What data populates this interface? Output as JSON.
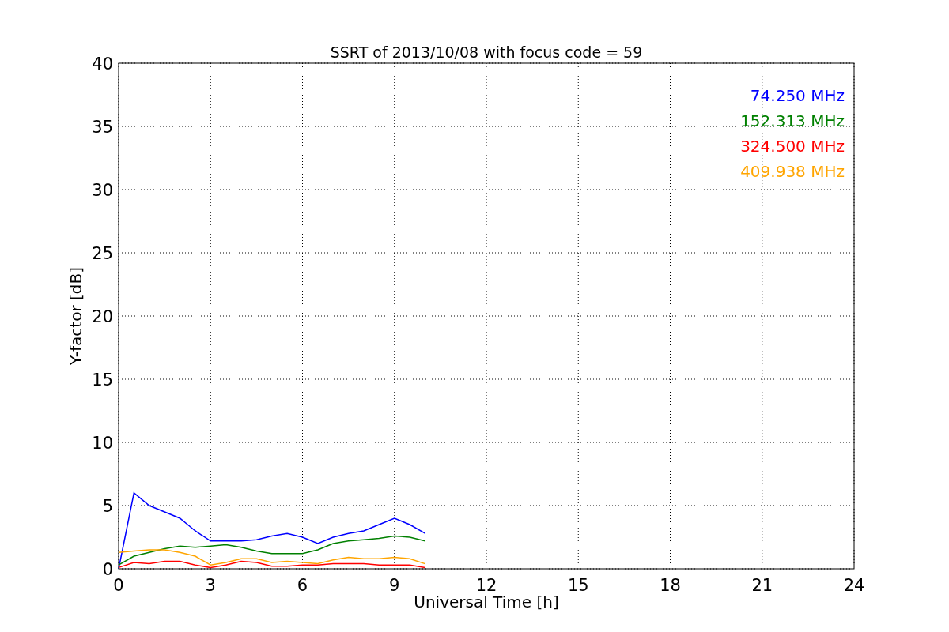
{
  "chart_data": {
    "type": "line",
    "title": "SSRT of 2013/10/08 with focus code = 59",
    "xlabel": "Universal Time [h]",
    "ylabel": "Y-factor [dB]",
    "x": [
      0,
      0.5,
      1,
      1.5,
      2,
      2.5,
      3,
      3.5,
      4,
      4.5,
      5,
      5.5,
      6,
      6.5,
      7,
      7.5,
      8,
      8.5,
      9,
      9.5,
      10
    ],
    "series": [
      {
        "name": "74.250 MHz",
        "color": "#0000ff",
        "values": [
          0,
          6,
          5,
          4.5,
          4,
          3,
          2.2,
          2.2,
          2.2,
          2.3,
          2.6,
          2.8,
          2.5,
          2,
          2.5,
          2.8,
          3,
          3.5,
          4,
          3.5,
          2.8
        ]
      },
      {
        "name": "152.313 MHz",
        "color": "#008000",
        "values": [
          0.3,
          1,
          1.3,
          1.6,
          1.8,
          1.7,
          1.8,
          1.9,
          1.7,
          1.4,
          1.2,
          1.2,
          1.2,
          1.5,
          2,
          2.2,
          2.3,
          2.4,
          2.6,
          2.5,
          2.2
        ]
      },
      {
        "name": "324.500 MHz",
        "color": "#ff0000",
        "values": [
          0.1,
          0.5,
          0.4,
          0.6,
          0.6,
          0.3,
          0.1,
          0.3,
          0.6,
          0.5,
          0.2,
          0.2,
          0.3,
          0.3,
          0.4,
          0.4,
          0.4,
          0.3,
          0.3,
          0.3,
          0.1
        ]
      },
      {
        "name": "409.938 MHz",
        "color": "#ffa500",
        "values": [
          1.3,
          1.4,
          1.5,
          1.5,
          1.3,
          1,
          0.3,
          0.5,
          0.8,
          0.8,
          0.5,
          0.6,
          0.5,
          0.4,
          0.7,
          0.9,
          0.8,
          0.8,
          0.9,
          0.8,
          0.4
        ]
      }
    ],
    "grid": true,
    "xlim": [
      0,
      24
    ],
    "ylim": [
      0,
      40
    ],
    "xticks": [
      0,
      3,
      6,
      9,
      12,
      15,
      18,
      21,
      24
    ],
    "yticks": [
      0,
      5,
      10,
      15,
      20,
      25,
      30,
      35,
      40
    ]
  }
}
